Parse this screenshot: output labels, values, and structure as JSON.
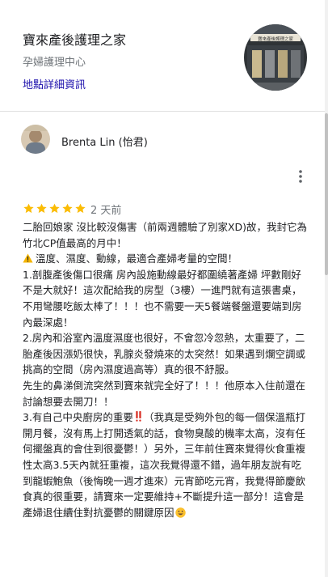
{
  "place": {
    "name": "寶來產後護理之家",
    "category": "孕婦護理中心",
    "details_link": "地點詳細資訊",
    "photo_sign": "寶來產後護理之家"
  },
  "review": {
    "author": "Brenta Lin (怡君)",
    "rating": 5,
    "max_rating": 5,
    "date": "2 天前",
    "paragraphs": [
      "二胎回娘家 沒比較沒傷害（前兩週體驗了別家XD)故，我封它為竹北CP值最高的月中！",
      "溫度、濕度、動線，最適合產婦考量的空間！",
      "1.剖腹產後傷口很痛 房內設施動線最好都圍繞著產婦 坪數剛好不是大就好！這次配給我的房型（3樓）一進門就有這張書桌，不用彎腰吃飯太棒了！！！也不需要一天5餐端餐盤還要端到房內最深處！",
      "2.房內和浴室內溫度濕度也很好，不會忽冷忽熱，太重要了，二胎產後因漲奶很快，乳腺炎發燒來的太突然！如果遇到爛空調或挑高的空間（房內濕度過高等）真的很不舒服。",
      "先生的鼻涕倒流突然到寶來就完全好了！！！他原本入住前還在討論想要去開刀！！",
      "3.有自己中央廚房的重要",
      "（我真是受夠外包的每一個保溫瓶打開月餐，沒有馬上打開透氣的話，食物臭酸的機率太高，沒有任何擺盤真的會住到很憂鬱！）另外，三年前住寶來覺得伙食重複性太高3.5天內就狂重複，這次我覺得還不錯，過年朋友說有吃到龍蝦鮑魚（後悔晚一週才進來）元宵節吃元宵，我覺得節慶飲食真的很重要，請寶來一定要維持+不斷提升這一部分！這會是產婦退住續住對抗憂鬱的關鍵原因"
    ]
  },
  "icons": {
    "star": "star-icon",
    "more": "more-vert-icon",
    "warning": "warning-emoji",
    "exclamation": "double-exclamation-emoji",
    "smile": "grinning-emoji"
  },
  "colors": {
    "star": "#fbbc04",
    "link": "#1a0dab",
    "secondary_text": "#70757a",
    "warning": "#f4b400",
    "exclamation": "#d93025"
  }
}
